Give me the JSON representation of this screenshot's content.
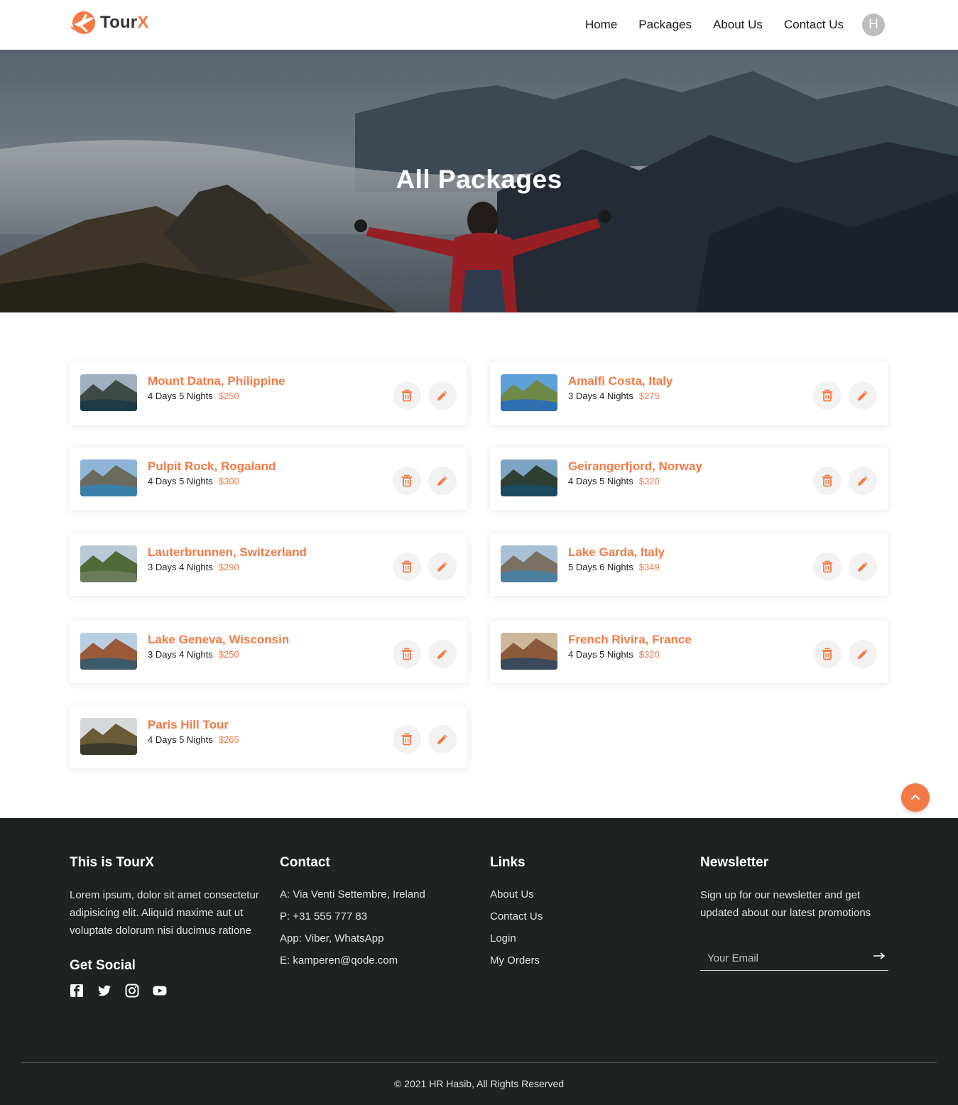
{
  "brand": {
    "name_main": "Tour",
    "name_accent": "X",
    "accent_color": "#f37a45"
  },
  "nav": {
    "items": [
      "Home",
      "Packages",
      "About Us",
      "Contact Us"
    ],
    "avatar_initial": "H"
  },
  "hero": {
    "title": "All Packages"
  },
  "packages": [
    {
      "title": "Mount Datna, Philippine",
      "duration": "4 Days 5 Nights",
      "price": "$250"
    },
    {
      "title": "Amalfi Costa, Italy",
      "duration": "3 Days 4 Nights",
      "price": "$275"
    },
    {
      "title": "Pulpit Rock, Rogaland",
      "duration": "4 Days 5 Nights",
      "price": "$300"
    },
    {
      "title": "Geirangerfjord, Norway",
      "duration": "4 Days 5 Nights",
      "price": "$320"
    },
    {
      "title": "Lauterbrunnen, Switzerland",
      "duration": "3 Days 4 Nights",
      "price": "$290"
    },
    {
      "title": "Lake Garda, Italy",
      "duration": "5 Days 6 Nights",
      "price": "$349"
    },
    {
      "title": "Lake Geneva, Wisconsin",
      "duration": "3 Days 4 Nights",
      "price": "$250"
    },
    {
      "title": "French Rivira, France",
      "duration": "4 Days 5 Nights",
      "price": "$320"
    },
    {
      "title": "Paris Hill Tour",
      "duration": "4 Days 5 Nights",
      "price": "$265"
    }
  ],
  "footer": {
    "about": {
      "heading": "This is TourX",
      "text": "Lorem ipsum, dolor sit amet consectetur adipisicing elit. Aliquid maxime aut ut voluptate dolorum nisi ducimus ratione",
      "social_heading": "Get Social",
      "social_icons": [
        "facebook-icon",
        "twitter-icon",
        "instagram-icon",
        "youtube-icon"
      ]
    },
    "contact": {
      "heading": "Contact",
      "lines": [
        "A: Via Venti Settembre, Ireland",
        "P: +31 555 777 83",
        "App: Viber, WhatsApp",
        "E: kamperen@qode.com"
      ]
    },
    "links": {
      "heading": "Links",
      "items": [
        "About Us",
        "Contact Us",
        "Login",
        "My Orders"
      ]
    },
    "newsletter": {
      "heading": "Newsletter",
      "text": "Sign up for our newsletter and get updated about our latest promotions",
      "placeholder": "Your Email"
    },
    "copyright": "© 2021 HR Hasib, All Rights Reserved"
  }
}
